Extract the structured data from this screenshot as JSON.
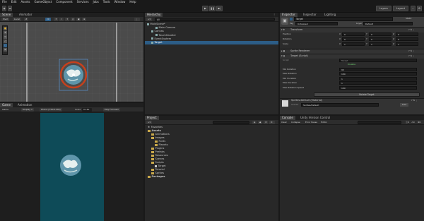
{
  "menu": [
    "File",
    "Edit",
    "Assets",
    "GameObject",
    "Component",
    "Services",
    "Jobs",
    "Tools",
    "Window",
    "Help"
  ],
  "toolbar": {
    "layers": "Layers",
    "layout": "Layout"
  },
  "scene": {
    "tabs": [
      "Scene",
      "Animator"
    ],
    "dropdowns": [
      "Pivot",
      "Local",
      "2D"
    ],
    "tools": [
      "hand",
      "move",
      "rotate",
      "scale",
      "rect",
      "transform",
      "custom"
    ]
  },
  "game": {
    "tabs": [
      "Game",
      "Animation"
    ],
    "display": "Game",
    "display_num": "Display 1",
    "resolution": "Phone (750x1440)",
    "scale_label": "Scale",
    "scale_value": "0.18x",
    "play_focused": "Play Focused"
  },
  "hierarchy": {
    "tab": "Hierarchy",
    "search_placeholder": "All",
    "items": [
      {
        "label": "MainScene*",
        "depth": 0,
        "type": "scene"
      },
      {
        "label": "Main Camera",
        "depth": 2,
        "type": "object"
      },
      {
        "label": "Canvas",
        "depth": 1,
        "type": "object"
      },
      {
        "label": "TouchHandler",
        "depth": 2,
        "type": "object"
      },
      {
        "label": "EventSystem",
        "depth": 1,
        "type": "object"
      },
      {
        "label": "Target",
        "depth": 1,
        "type": "object",
        "selected": true
      }
    ]
  },
  "project": {
    "tab": "Project",
    "items": [
      {
        "label": "Favorites",
        "depth": 0,
        "type": "star"
      },
      {
        "label": "Assets",
        "depth": 0,
        "type": "folder",
        "bold": true
      },
      {
        "label": "Animations",
        "depth": 1,
        "type": "folder"
      },
      {
        "label": "Images",
        "depth": 1,
        "type": "folder"
      },
      {
        "label": "Fonts",
        "depth": 2,
        "type": "folder"
      },
      {
        "label": "Planets",
        "depth": 2,
        "type": "folder"
      },
      {
        "label": "Plugins",
        "depth": 1,
        "type": "folder"
      },
      {
        "label": "Prefabs",
        "depth": 1,
        "type": "folder"
      },
      {
        "label": "Resources",
        "depth": 1,
        "type": "folder"
      },
      {
        "label": "Scenes",
        "depth": 1,
        "type": "folder"
      },
      {
        "label": "Scripts",
        "depth": 1,
        "type": "folder"
      },
      {
        "label": "Target",
        "depth": 2,
        "type": "script"
      },
      {
        "label": "Tutorial",
        "depth": 1,
        "type": "folder"
      },
      {
        "label": "Sprites",
        "depth": 1,
        "type": "folder"
      },
      {
        "label": "Packages",
        "depth": 0,
        "type": "folder",
        "bold": true
      }
    ]
  },
  "console": {
    "tabs": [
      "Console",
      "Unity Version Control"
    ],
    "buttons": [
      "Clear",
      "Collapse",
      "Error Pause",
      "Editor"
    ]
  },
  "inspector": {
    "tabs": [
      "Inspector",
      "Inspector",
      "Lighting"
    ],
    "object_name": "Target",
    "static_label": "Static",
    "tag_label": "Tag",
    "tag_value": "Untagged",
    "layer_label": "Layer",
    "layer_value": "Default",
    "transform": {
      "title": "Transform",
      "rows": [
        {
          "label": "Position",
          "x": "0",
          "y": "0",
          "z": "0"
        },
        {
          "label": "Rotation",
          "x": "0",
          "y": "0",
          "z": "0"
        },
        {
          "label": "Scale",
          "x": "1",
          "y": "1",
          "z": "1"
        }
      ]
    },
    "sprite_renderer": {
      "title": "Sprite Renderer"
    },
    "script": {
      "title": "Target (Script)",
      "script_label": "Script",
      "script_value": "Target",
      "status": "Disable",
      "fields": [
        {
          "label": "Min Rotation",
          "value": "90"
        },
        {
          "label": "Max Rotation",
          "value": "180"
        },
        {
          "label": "Min Duration",
          "value": "1"
        },
        {
          "label": "Max Duration",
          "value": "1"
        },
        {
          "label": "Max Rotation Speed",
          "value": "180"
        }
      ],
      "button": "Rotate Target"
    },
    "material": {
      "title": "Sprites-Default (Material)",
      "shader_label": "Shader",
      "shader_value": "Sprites/Default",
      "edit": "Edit"
    }
  },
  "colors": {
    "accent": "#2c5d87",
    "game_bg": "#0e4b58",
    "ring": "#c8401c"
  }
}
